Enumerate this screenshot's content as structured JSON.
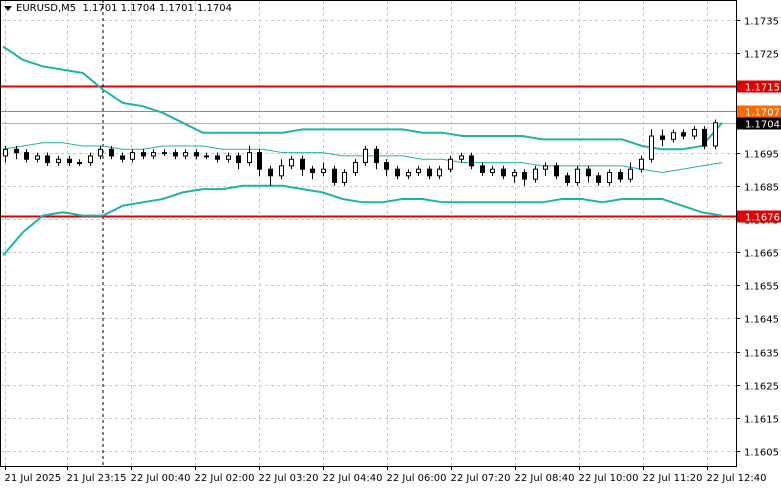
{
  "header": {
    "symbol": "EURUSD,M5",
    "ohlc": "1.1701 1.1704 1.1701 1.1704"
  },
  "chart_data": {
    "type": "candlestick",
    "ylim": [
      1.16,
      1.174
    ],
    "grid": true,
    "y_ticks": [
      "1.1735",
      "1.1725",
      "1.1715",
      "1.1695",
      "1.1685",
      "1.1675",
      "1.1665",
      "1.1655",
      "1.1645",
      "1.1635",
      "1.1625",
      "1.1615",
      "1.1605"
    ],
    "x_ticks": [
      "21 Jul 2025",
      "21 Jul 23:15",
      "22 Jul 00:40",
      "22 Jul 02:00",
      "22 Jul 03:20",
      "22 Jul 04:40",
      "22 Jul 06:00",
      "22 Jul 07:20",
      "22 Jul 08:40",
      "22 Jul 10:00",
      "22 Jul 11:20",
      "22 Jul 12:40"
    ],
    "levels": [
      {
        "label": "1.1715",
        "value": 1.1715,
        "color": "#e00000"
      },
      {
        "label": "1.1707",
        "value": 1.17075,
        "color": "#ff6a00"
      },
      {
        "label": "1.1676",
        "value": 1.1676,
        "color": "#e00000"
      }
    ],
    "current_price": {
      "label": "1.1704",
      "value": 1.1704
    },
    "cursor_x_label": "21 Jul 23:15",
    "bollinger_upper": [
      1.1727,
      1.1723,
      1.1721,
      1.172,
      1.1719,
      1.1714,
      1.171,
      1.1709,
      1.1707,
      1.1704,
      1.1701,
      1.1701,
      1.1701,
      1.1701,
      1.1701,
      1.1702,
      1.1702,
      1.1702,
      1.1702,
      1.1702,
      1.1702,
      1.1701,
      1.1701,
      1.17,
      1.17,
      1.17,
      1.17,
      1.1699,
      1.1699,
      1.1699,
      1.1699,
      1.1699,
      1.1697,
      1.1696,
      1.1696,
      1.1697,
      1.1704
    ],
    "bollinger_middle": [
      1.1696,
      1.1697,
      1.1698,
      1.1698,
      1.1697,
      1.1697,
      1.1696,
      1.1696,
      1.1697,
      1.1697,
      1.1697,
      1.1696,
      1.1696,
      1.1696,
      1.1695,
      1.1695,
      1.1695,
      1.1694,
      1.1694,
      1.1694,
      1.1694,
      1.1693,
      1.1693,
      1.1692,
      1.1692,
      1.1692,
      1.1692,
      1.1691,
      1.1691,
      1.1691,
      1.1691,
      1.1691,
      1.169,
      1.1689,
      1.169,
      1.1691,
      1.1692
    ],
    "bollinger_lower": [
      1.1664,
      1.1671,
      1.1676,
      1.1677,
      1.1676,
      1.1676,
      1.1679,
      1.168,
      1.1681,
      1.1683,
      1.1684,
      1.1684,
      1.1685,
      1.1685,
      1.1685,
      1.1684,
      1.1683,
      1.1681,
      1.168,
      1.168,
      1.1681,
      1.1681,
      1.168,
      1.168,
      1.168,
      1.168,
      1.168,
      1.168,
      1.1681,
      1.1681,
      1.168,
      1.1681,
      1.1681,
      1.1681,
      1.1679,
      1.1677,
      1.1676
    ],
    "candles": [
      [
        1.1694,
        1.1696,
        1.1697,
        1.1692
      ],
      [
        1.1696,
        1.1695,
        1.1697,
        1.1693
      ],
      [
        1.1695,
        1.1693,
        1.1696,
        1.1692
      ],
      [
        1.1693,
        1.1694,
        1.1695,
        1.1692
      ],
      [
        1.1694,
        1.1692,
        1.1695,
        1.1691
      ],
      [
        1.1692,
        1.1693,
        1.1694,
        1.1691
      ],
      [
        1.1693,
        1.1692,
        1.1694,
        1.1691
      ],
      [
        1.1692,
        1.1692,
        1.1693,
        1.1691
      ],
      [
        1.1692,
        1.1694,
        1.1695,
        1.1691
      ],
      [
        1.1694,
        1.1696,
        1.1697,
        1.1693
      ],
      [
        1.1696,
        1.1694,
        1.1697,
        1.1693
      ],
      [
        1.1694,
        1.1693,
        1.1695,
        1.1692
      ],
      [
        1.1693,
        1.1695,
        1.1696,
        1.1692
      ],
      [
        1.1695,
        1.1694,
        1.1696,
        1.1693
      ],
      [
        1.1694,
        1.1695,
        1.1696,
        1.1693
      ],
      [
        1.1695,
        1.1695,
        1.1696,
        1.1694
      ],
      [
        1.1695,
        1.1694,
        1.1696,
        1.1693
      ],
      [
        1.1694,
        1.1695,
        1.1696,
        1.1693
      ],
      [
        1.1695,
        1.1694,
        1.1696,
        1.1693
      ],
      [
        1.1694,
        1.1694,
        1.1695,
        1.1693
      ],
      [
        1.1694,
        1.1693,
        1.1695,
        1.1692
      ],
      [
        1.1693,
        1.1694,
        1.1695,
        1.1692
      ],
      [
        1.1694,
        1.1692,
        1.1695,
        1.169
      ],
      [
        1.1692,
        1.1695,
        1.1697,
        1.1691
      ],
      [
        1.1695,
        1.169,
        1.1696,
        1.1688
      ],
      [
        1.169,
        1.1688,
        1.1691,
        1.1685
      ],
      [
        1.1688,
        1.1691,
        1.1693,
        1.1687
      ],
      [
        1.1691,
        1.1693,
        1.1694,
        1.169
      ],
      [
        1.1693,
        1.169,
        1.1694,
        1.1688
      ],
      [
        1.169,
        1.1689,
        1.1691,
        1.1687
      ],
      [
        1.1689,
        1.169,
        1.1692,
        1.1688
      ],
      [
        1.169,
        1.1686,
        1.1691,
        1.1685
      ],
      [
        1.1686,
        1.1689,
        1.169,
        1.1685
      ],
      [
        1.1689,
        1.1692,
        1.1693,
        1.1688
      ],
      [
        1.1692,
        1.1696,
        1.1697,
        1.1691
      ],
      [
        1.1696,
        1.1692,
        1.1697,
        1.169
      ],
      [
        1.1692,
        1.169,
        1.1693,
        1.1688
      ],
      [
        1.169,
        1.1688,
        1.1691,
        1.1687
      ],
      [
        1.1688,
        1.1689,
        1.169,
        1.1687
      ],
      [
        1.1689,
        1.169,
        1.1691,
        1.1688
      ],
      [
        1.169,
        1.1688,
        1.1691,
        1.1687
      ],
      [
        1.1688,
        1.169,
        1.1691,
        1.1687
      ],
      [
        1.169,
        1.1693,
        1.1694,
        1.1689
      ],
      [
        1.1693,
        1.1694,
        1.1695,
        1.1692
      ],
      [
        1.1694,
        1.1691,
        1.1695,
        1.169
      ],
      [
        1.1691,
        1.1689,
        1.1692,
        1.1688
      ],
      [
        1.1689,
        1.169,
        1.1691,
        1.1688
      ],
      [
        1.169,
        1.1688,
        1.1691,
        1.1687
      ],
      [
        1.1688,
        1.1689,
        1.169,
        1.1686
      ],
      [
        1.1689,
        1.1687,
        1.169,
        1.1685
      ],
      [
        1.1687,
        1.169,
        1.1691,
        1.1686
      ],
      [
        1.169,
        1.1691,
        1.1692,
        1.1688
      ],
      [
        1.1691,
        1.1688,
        1.1692,
        1.1687
      ],
      [
        1.1688,
        1.1686,
        1.1689,
        1.1685
      ],
      [
        1.1686,
        1.169,
        1.1691,
        1.1685
      ],
      [
        1.169,
        1.1688,
        1.1691,
        1.1686
      ],
      [
        1.1688,
        1.1686,
        1.1689,
        1.1685
      ],
      [
        1.1686,
        1.1689,
        1.169,
        1.1685
      ],
      [
        1.1689,
        1.1687,
        1.169,
        1.1686
      ],
      [
        1.1687,
        1.169,
        1.1692,
        1.1686
      ],
      [
        1.169,
        1.1693,
        1.1694,
        1.1689
      ],
      [
        1.1693,
        1.17,
        1.1702,
        1.1692
      ],
      [
        1.17,
        1.1699,
        1.1702,
        1.1697
      ],
      [
        1.1699,
        1.1701,
        1.1702,
        1.1698
      ],
      [
        1.1701,
        1.17,
        1.1702,
        1.1699
      ],
      [
        1.17,
        1.1702,
        1.1703,
        1.1699
      ],
      [
        1.1702,
        1.1697,
        1.1703,
        1.1696
      ],
      [
        1.1697,
        1.1704,
        1.1705,
        1.1696
      ]
    ]
  }
}
